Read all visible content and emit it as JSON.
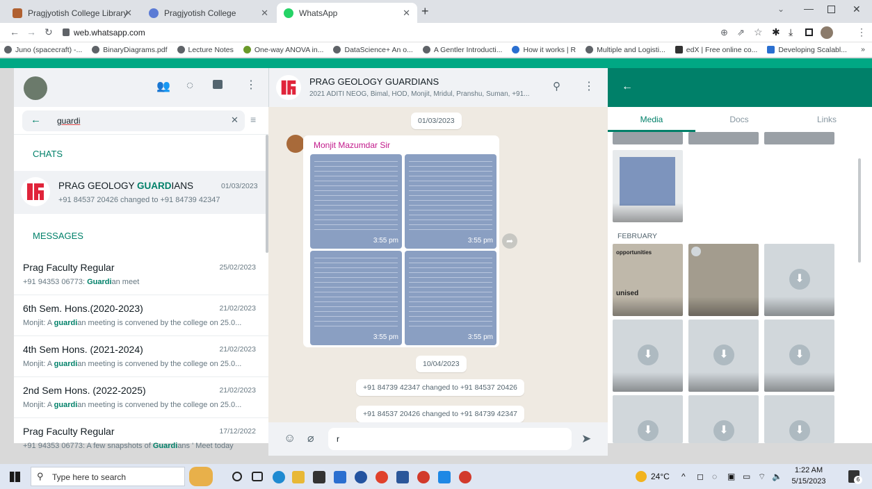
{
  "browser": {
    "tabs": [
      {
        "title": "Pragjyotish College Library",
        "color": "#b06030"
      },
      {
        "title": "Pragjyotish College",
        "color": "#5b7bd5"
      },
      {
        "title": "WhatsApp",
        "color": "#25d366"
      }
    ],
    "url": "web.whatsapp.com",
    "bookmarks": [
      "Juno (spacecraft) -...",
      "BinaryDiagrams.pdf",
      "Lecture Notes",
      "One-way ANOVA in...",
      "DataScience+ An o...",
      "A Gentler Introducti...",
      "How it works | R",
      "Multiple and Logisti...",
      "edX | Free online co...",
      "Developing Scalabl..."
    ],
    "more_bookmarks": "»"
  },
  "left": {
    "search_value": "guardi",
    "section_chats": "CHATS",
    "chat": {
      "name_pre": "PRAG GEOLOGY ",
      "name_hl": "GUARD",
      "name_post": "IANS",
      "date": "01/03/2023",
      "snippet": "+91 84537 20426 changed to +91 84739 42347"
    },
    "section_messages": "MESSAGES",
    "messages": [
      {
        "title": "Prag Faculty Regular",
        "date": "25/02/2023",
        "pre": "+91 94353 06773: ",
        "hl": "Guardi",
        "post": "an meet"
      },
      {
        "title": "6th Sem. Hons.(2020-2023)",
        "date": "21/02/2023",
        "pre": "Monjit: A ",
        "hl": "guardi",
        "post": "an meeting is convened by the college on 25.0..."
      },
      {
        "title": "4th Sem Hons. (2021-2024)",
        "date": "21/02/2023",
        "pre": "Monjit: A ",
        "hl": "guardi",
        "post": "an meeting is convened by the college on 25.0..."
      },
      {
        "title": "2nd Sem Hons. (2022-2025)",
        "date": "21/02/2023",
        "pre": "Monjit: A ",
        "hl": "guardi",
        "post": "an meeting is convened by the college on 25.0..."
      },
      {
        "title": "Prag Faculty Regular",
        "date": "17/12/2022",
        "pre": "+91 94353 06773: A few snapshots of ",
        "hl": "Guardi",
        "post": "ans ' Meet today"
      }
    ]
  },
  "chat": {
    "title": "PRAG GEOLOGY GUARDIANS",
    "members": "2021 ADITI NEOG, Bimal, HOD, Monjit, Mridul, Pranshu, Suman, +91...",
    "date1": "01/03/2023",
    "sender": "Monjit Mazumdar Sir",
    "photo_times": [
      "3:55 pm",
      "3:55 pm",
      "3:55 pm",
      "3:55 pm"
    ],
    "date2": "10/04/2023",
    "system1": "+91 84739 42347 changed to +91 84537 20426",
    "system2": "+91 84537 20426 changed to +91 84739 42347",
    "composer_value": "r"
  },
  "media": {
    "tabs": [
      "Media",
      "Docs",
      "Links"
    ],
    "month": "FEBRUARY",
    "clip_text_1": "opportunities",
    "clip_text_2": "unised"
  },
  "taskbar": {
    "search_placeholder": "Type here to search",
    "weather": "24°C",
    "time": "1:22 AM",
    "date": "5/15/2023",
    "notif_count": "6"
  }
}
